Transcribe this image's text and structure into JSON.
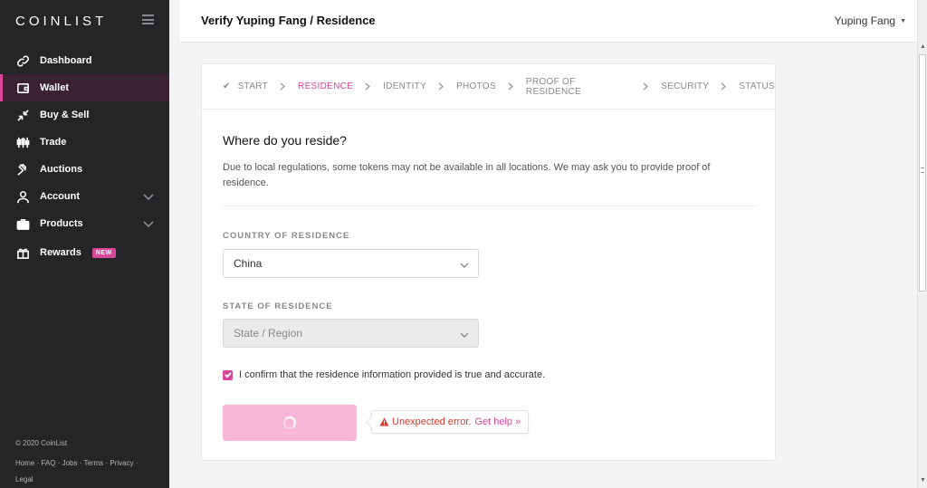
{
  "sidebar": {
    "brand": "COINLIST",
    "items": [
      {
        "label": "Dashboard",
        "icon": "link-icon"
      },
      {
        "label": "Wallet",
        "icon": "wallet-icon",
        "active": true
      },
      {
        "label": "Buy & Sell",
        "icon": "arrows-icon"
      },
      {
        "label": "Trade",
        "icon": "candlestick-icon"
      },
      {
        "label": "Auctions",
        "icon": "gavel-icon"
      },
      {
        "label": "Account",
        "icon": "user-icon",
        "expandable": true
      },
      {
        "label": "Products",
        "icon": "briefcase-icon",
        "expandable": true
      },
      {
        "label": "Rewards",
        "icon": "gift-icon",
        "badge": "NEW"
      }
    ],
    "footer": {
      "copyright": "© 2020 CoinList",
      "links": [
        "Home",
        "FAQ",
        "Jobs",
        "Terms",
        "Privacy",
        "Legal"
      ]
    }
  },
  "header": {
    "title": "Verify Yuping Fang / Residence",
    "user": "Yuping Fang"
  },
  "steps": [
    "START",
    "RESIDENCE",
    "IDENTITY",
    "PHOTOS",
    "PROOF OF RESIDENCE",
    "SECURITY",
    "STATUS"
  ],
  "form": {
    "question": "Where do you reside?",
    "description": "Due to local regulations, some tokens may not be available in all locations. We may ask you to provide proof of residence.",
    "country_label": "COUNTRY OF RESIDENCE",
    "country_value": "China",
    "state_label": "STATE OF RESIDENCE",
    "state_placeholder": "State / Region",
    "confirm_text": "I confirm that the residence information provided is true and accurate.",
    "confirm_checked": true
  },
  "error": {
    "message": "Unexpected error.",
    "help": "Get help »"
  },
  "colors": {
    "accent": "#d8479a",
    "sidebar_bg": "#252527",
    "button_loading": "#f8b6d9",
    "error": "#d9382a"
  }
}
